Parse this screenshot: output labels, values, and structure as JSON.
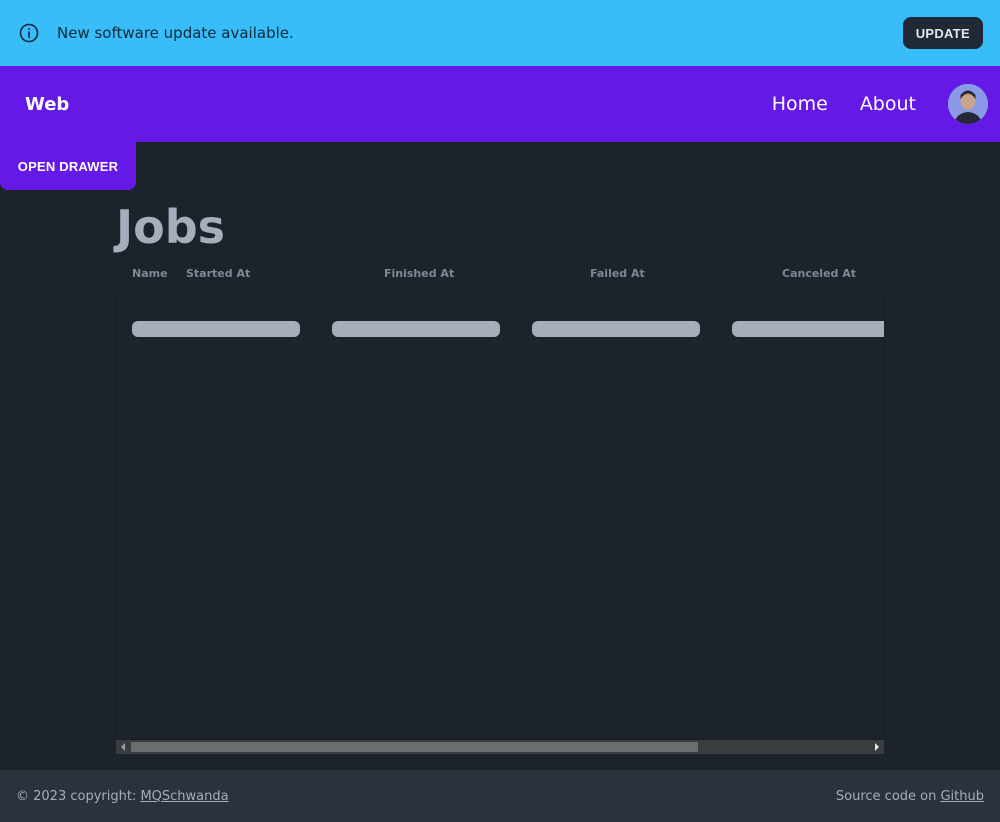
{
  "alert": {
    "icon": "info-icon",
    "message": "New software update available.",
    "button_label": "UPDATE",
    "background": "#38bdf8"
  },
  "navbar": {
    "brand": "Web",
    "links": [
      "Home",
      "About"
    ],
    "background": "#6419e6"
  },
  "drawer": {
    "button_label": "OPEN DRAWER"
  },
  "page": {
    "title": "Jobs"
  },
  "table": {
    "columns": [
      "Name",
      "Started At",
      "Finished At",
      "Failed At",
      "Canceled At"
    ],
    "loading_rows": 1
  },
  "footer": {
    "copyright_prefix": "© 2023 copyright: ",
    "copyright_link": "MQSchwanda",
    "source_prefix": "Source code on ",
    "source_link": "Github"
  }
}
